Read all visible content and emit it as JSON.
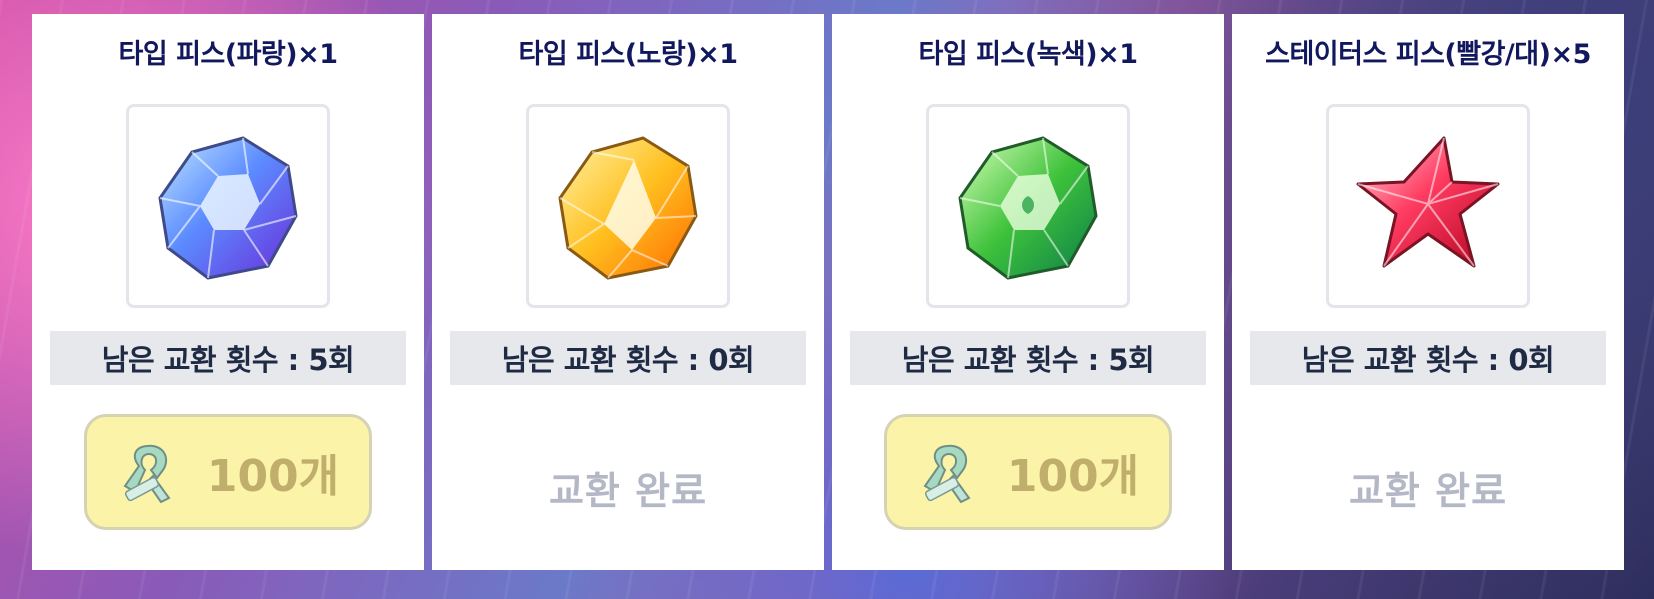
{
  "cards": [
    {
      "title": "타입 피스(파랑)×1",
      "remaining": "남은 교환 횟수 : 5회",
      "action": "100개",
      "gem": "blue-gem-icon"
    },
    {
      "title": "타입 피스(노랑)×1",
      "remaining": "남은 교환 횟수 : 0회",
      "action": "교환 완료",
      "gem": "yellow-gem-icon"
    },
    {
      "title": "타입 피스(녹색)×1",
      "remaining": "남은 교환 횟수 : 5회",
      "action": "100개",
      "gem": "green-gem-icon"
    },
    {
      "title": "스테이터스 피스(빨강/대)×5",
      "remaining": "남은 교환 횟수 : 0회",
      "action": "교환 완료",
      "gem": "red-star-gem-icon"
    }
  ],
  "colors": {
    "title": "#12185e",
    "button_bg": "#fbf3a8",
    "count_bar_bg": "#e6e8ec",
    "done_text": "#b4b7c5"
  }
}
